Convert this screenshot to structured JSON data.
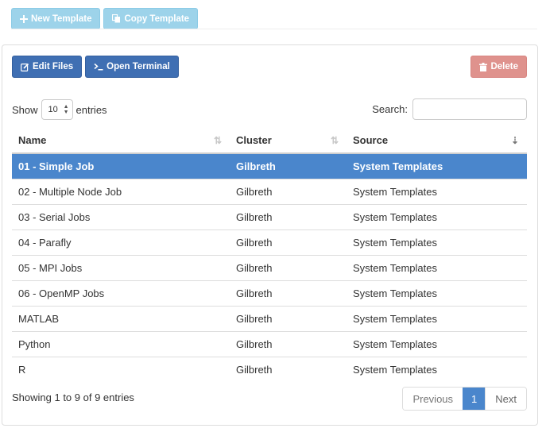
{
  "toolbar": {
    "new_template_label": "New Template",
    "copy_template_label": "Copy Template"
  },
  "panel": {
    "edit_files_label": "Edit Files",
    "open_terminal_label": "Open Terminal",
    "delete_label": "Delete"
  },
  "table_controls": {
    "show_label": "Show",
    "entries_label": "entries",
    "page_length_value": "10",
    "search_label": "Search:",
    "search_value": ""
  },
  "table": {
    "headers": {
      "name": "Name",
      "cluster": "Cluster",
      "source": "Source"
    },
    "rows": [
      {
        "name": "01 - Simple Job",
        "cluster": "Gilbreth",
        "source": "System Templates",
        "selected": true
      },
      {
        "name": "02 - Multiple Node Job",
        "cluster": "Gilbreth",
        "source": "System Templates"
      },
      {
        "name": "03 - Serial Jobs",
        "cluster": "Gilbreth",
        "source": "System Templates"
      },
      {
        "name": "04 - Parafly",
        "cluster": "Gilbreth",
        "source": "System Templates"
      },
      {
        "name": "05 - MPI Jobs",
        "cluster": "Gilbreth",
        "source": "System Templates"
      },
      {
        "name": "06 - OpenMP Jobs",
        "cluster": "Gilbreth",
        "source": "System Templates"
      },
      {
        "name": "MATLAB",
        "cluster": "Gilbreth",
        "source": "System Templates"
      },
      {
        "name": "Python",
        "cluster": "Gilbreth",
        "source": "System Templates"
      },
      {
        "name": "R",
        "cluster": "Gilbreth",
        "source": "System Templates"
      }
    ]
  },
  "footer": {
    "info": "Showing 1 to 9 of 9 entries",
    "previous_label": "Previous",
    "current_page": "1",
    "next_label": "Next"
  },
  "colors": {
    "primary": "#3f6fb3",
    "info_disabled": "#9dd3ea",
    "danger_disabled": "#df928d",
    "selected_row": "#4a86cc"
  },
  "icons": {
    "new_template": "plus-icon",
    "copy_template": "copy-icon",
    "edit_files": "edit-icon",
    "open_terminal": "terminal-icon",
    "delete": "trash-icon"
  }
}
